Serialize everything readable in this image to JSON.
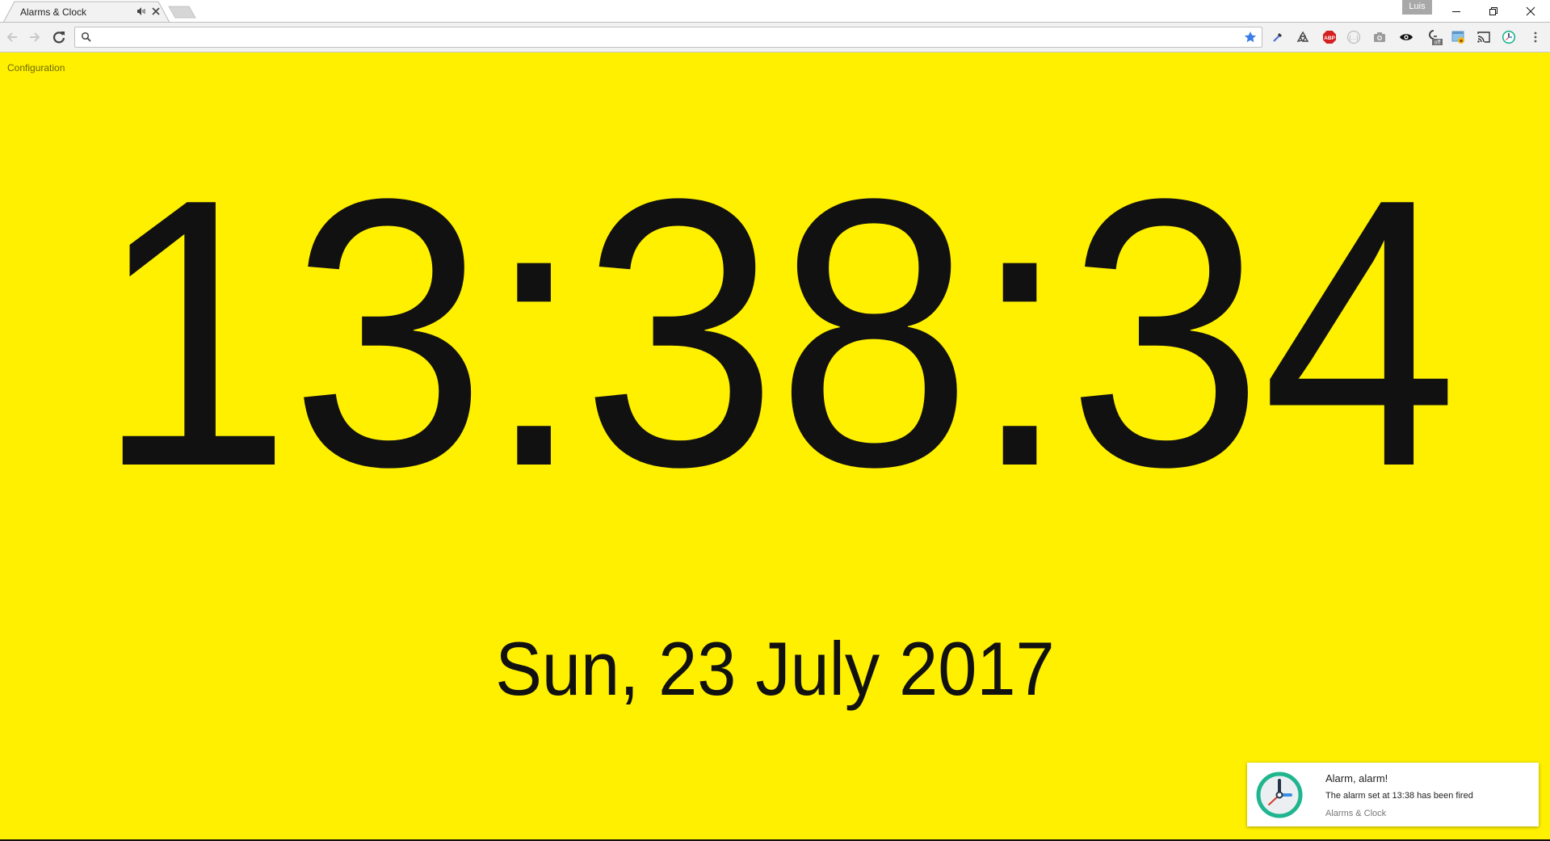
{
  "browser": {
    "tab": {
      "title": "Alarms & Clock",
      "audio_icon": "speaker-icon",
      "close_icon": "close-icon"
    },
    "profile_name": "Luis",
    "window_controls": [
      "minimize",
      "restore",
      "close"
    ],
    "omnibox": {
      "value": "",
      "placeholder": ""
    },
    "extensions": [
      "eyedropper-icon",
      "recycle-icon",
      "adblock-plus-icon",
      "braces-icon",
      "camera-icon",
      "eye-icon",
      "caffeine-off-icon",
      "window-lock-icon",
      "cast-icon",
      "alarm-clock-icon",
      "menu-icon"
    ],
    "extension_badge": "off"
  },
  "page": {
    "background_color": "#fff000",
    "config_link": "Configuration",
    "time": "13:38:34",
    "date": "Sun, 23 July 2017"
  },
  "notification": {
    "title": "Alarm, alarm!",
    "message": "The alarm set at 13:38 has been fired",
    "source": "Alarms & Clock",
    "icon": "clock-icon"
  }
}
